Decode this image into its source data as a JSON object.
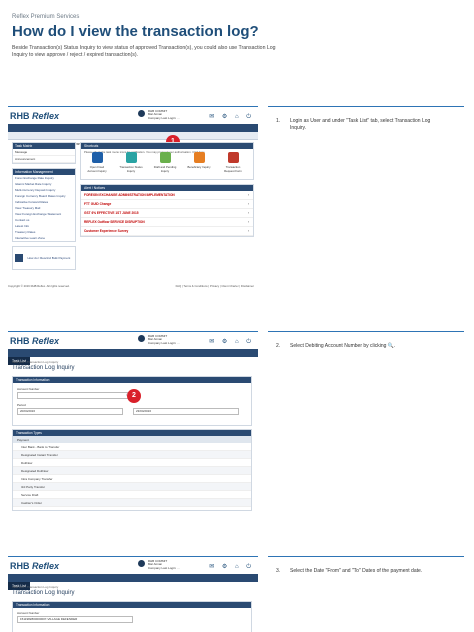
{
  "header": {
    "brand": "Reflex Premium Services",
    "title": "How do I view the transaction log?",
    "desc": "Beside Transaction(s) Status Inquiry to view status of approved Transaction(s), you could also use Transaction Log Inquiry to view approve / reject / expired transaction(s)."
  },
  "app": {
    "logo_rhb": "RHB",
    "logo_reflex": "Reflex",
    "user_line1": "RHB COMMIT",
    "user_line2": "Mar Aiman",
    "user_line3": "Company Last Login: ...",
    "icons": "✉ ⚙ ⌂ ⏻"
  },
  "nav": [
    "Task List",
    "Services",
    "Account Management",
    "Payment",
    "Collection",
    "Liquidity Management",
    "Trade",
    "Reports"
  ],
  "steps": [
    {
      "num": "1.",
      "text": "Login as User and under \"Task List\" tab, select Transaction Log Inquiry."
    },
    {
      "num": "2.",
      "text": "Select Debiting Account Number by clicking 🔍."
    },
    {
      "num": "3.",
      "text": "Select the Date \"From\" and \"To\" Dates of the payment date."
    }
  ],
  "shot1": {
    "tabs": [
      "Transaction Authorisation Inquiry",
      "Transaction Status Inquiry",
      "Transaction Log Inquiry"
    ],
    "marker": "1",
    "task_head": "Task Matrix",
    "task_rows": [
      "Message",
      "Announcement"
    ],
    "info_head": "Information Management",
    "info_links": [
      "Forex Exchange Rate Inquiry",
      "Islamic Market Rate Inquiry",
      "Multi-Currency Deposit Inquiry",
      "Foreign Currency Board Rates Inquiry",
      "Indicative Forward Rates",
      "View Treasury Mail",
      "View Foreign Exchange Statement",
      "Contact us",
      "Latest Info",
      "Treasury Rates",
      "Interactive Learn Zone"
    ],
    "bulk_head": "How do I Rescind Bulk Payment",
    "shortcut_head": "Shortcuts",
    "shortcut_note": "Please check the task menu icons for notification. You may proceed your authorisation. Click here",
    "shortcuts": [
      "Open Fixed Account Inquiry",
      "Transaction Status Inquiry",
      "Draft and Pending Inquiry",
      "Beneficiary Inquiry",
      "Transaction Request Form"
    ],
    "alerts_head": "Alert / Notices",
    "alerts": [
      "FOREIGN EXCHANGE ADMINISTRATION IMPLEMENTATION",
      "FTT GUID Change",
      "GST 6% EFFECTIVE 1ST JUNE 2015",
      "REFLEX Outflow SERVICE DISRUPTION",
      "Customer Experience Survey"
    ],
    "footer_left": "Copyright © 2016 RHB Reflex. All rights reserved.",
    "footer_right": "FAQ | Terms & Conditions | Privacy | Client Charter | Disclaimer"
  },
  "shot2": {
    "crumb": "Task List  >  Transaction Log Inquiry",
    "title": "Transaction Log Inquiry",
    "info_bar": "Transaction Information",
    "acct_label": "Account Number",
    "period_label": "Period",
    "from_val": "20/04/2016",
    "to_val": "23/04/2016",
    "marker": "2",
    "tt_bar": "Transaction Types",
    "tt_head": "Payment",
    "tt_rows": [
      "Inter Bank - Bank to Transfer",
      "Designated Instant Transfer",
      "DuitNow",
      "Designated DuitNow",
      "Intra Company Transfer",
      "3rd Party Transfer",
      "Service Draft",
      "Cashier's Order"
    ]
  },
  "shot3": {
    "crumb": "Task List  >  Transaction Log Inquiry",
    "title": "Transaction Log Inquiry",
    "info_bar": "Transaction Information",
    "acct_label": "Account Number",
    "acct_val": "1511982800000007-VILLAGE DEFENDER"
  }
}
